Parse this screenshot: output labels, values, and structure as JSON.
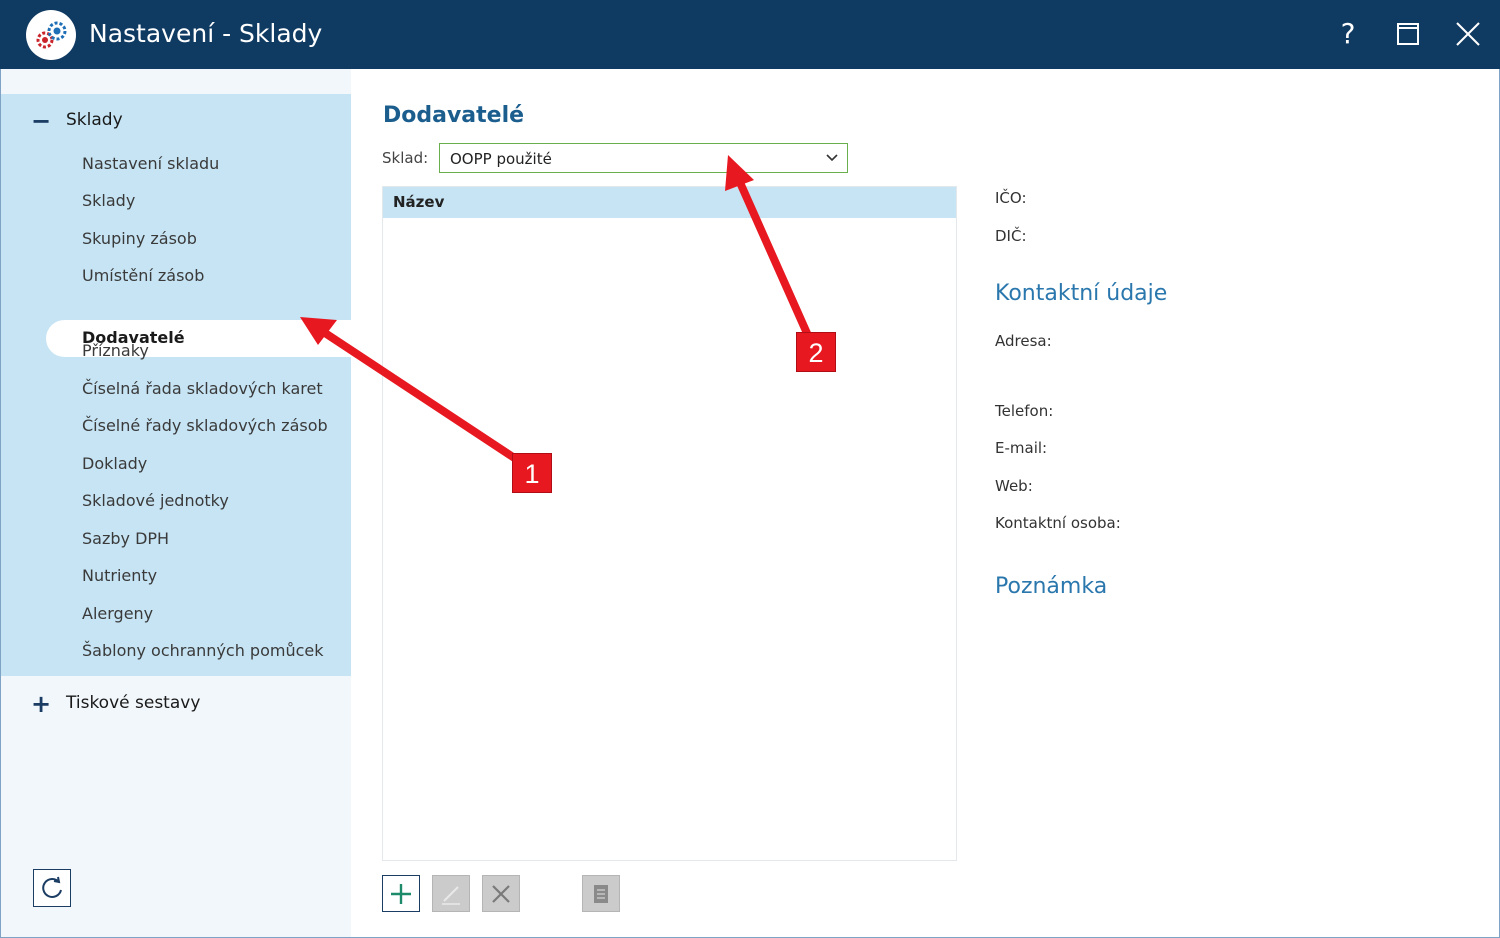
{
  "window": {
    "title": "Nastavení - Sklady",
    "help_label": "?",
    "icon": "gears-icon"
  },
  "sidebar": {
    "group_open": {
      "label": "Sklady",
      "toggle": "−"
    },
    "items": [
      "Nastavení skladu",
      "Sklady",
      "Skupiny zásob",
      "Umístění zásob",
      "Dodavatelé",
      "Příznaky",
      "Číselná řada skladových karet",
      "Číselné řady skladových zásob",
      "Doklady",
      "Skladové jednotky",
      "Sazby DPH",
      "Nutrienty",
      "Alergeny",
      "Šablony ochranných pomůcek"
    ],
    "active_item": "Dodavatelé",
    "group_closed": {
      "label": "Tiskové sestavy",
      "toggle": "+"
    }
  },
  "main": {
    "title": "Dodavatelé",
    "sklad_label": "Sklad:",
    "sklad_value": "OOPP použité",
    "grid_header": "Název",
    "detail": {
      "ico": "IČO:",
      "dic": "DIČ:",
      "contacts_heading": "Kontaktní údaje",
      "adresa": "Adresa:",
      "telefon": "Telefon:",
      "email": "E-mail:",
      "web": "Web:",
      "kontaktni_osoba": "Kontaktní osoba:",
      "note_heading": "Poznámka"
    }
  },
  "annotations": {
    "badge_1": "1",
    "badge_2": "2",
    "color": "#e81820"
  },
  "colors": {
    "titlebar": "#0f3a62",
    "sidebar_group": "#c6e4f4",
    "heading": "#1b5e8e",
    "detail_heading": "#2a77ad",
    "dropdown_border": "#6aaf4e"
  }
}
